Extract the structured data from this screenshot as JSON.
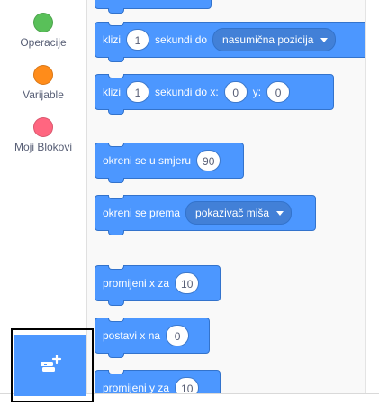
{
  "categories": [
    {
      "label": "Operacije",
      "color": "#59c059"
    },
    {
      "label": "Varijable",
      "color": "#ff8c1a"
    },
    {
      "label": "Moji Blokovi",
      "color": "#ff6680"
    }
  ],
  "blocks": {
    "glide_random": {
      "text1": "klizi",
      "secs": "1",
      "text2": "sekundi do",
      "dropdown": "nasumična pozicija"
    },
    "glide_xy": {
      "text1": "klizi",
      "secs": "1",
      "text2": "sekundi do x:",
      "x": "0",
      "ylabel": "y:",
      "y": "0"
    },
    "point_dir": {
      "text": "okreni se u smjeru",
      "value": "90"
    },
    "point_towards": {
      "text": "okreni se prema",
      "dropdown": "pokazivač miša"
    },
    "change_x": {
      "text": "promijeni x za",
      "value": "10"
    },
    "set_x": {
      "text": "postavi x na",
      "value": "0"
    },
    "change_y": {
      "text": "promijeni y za",
      "value": "10"
    }
  },
  "extension_button": {
    "icon": "add-extension-icon"
  }
}
